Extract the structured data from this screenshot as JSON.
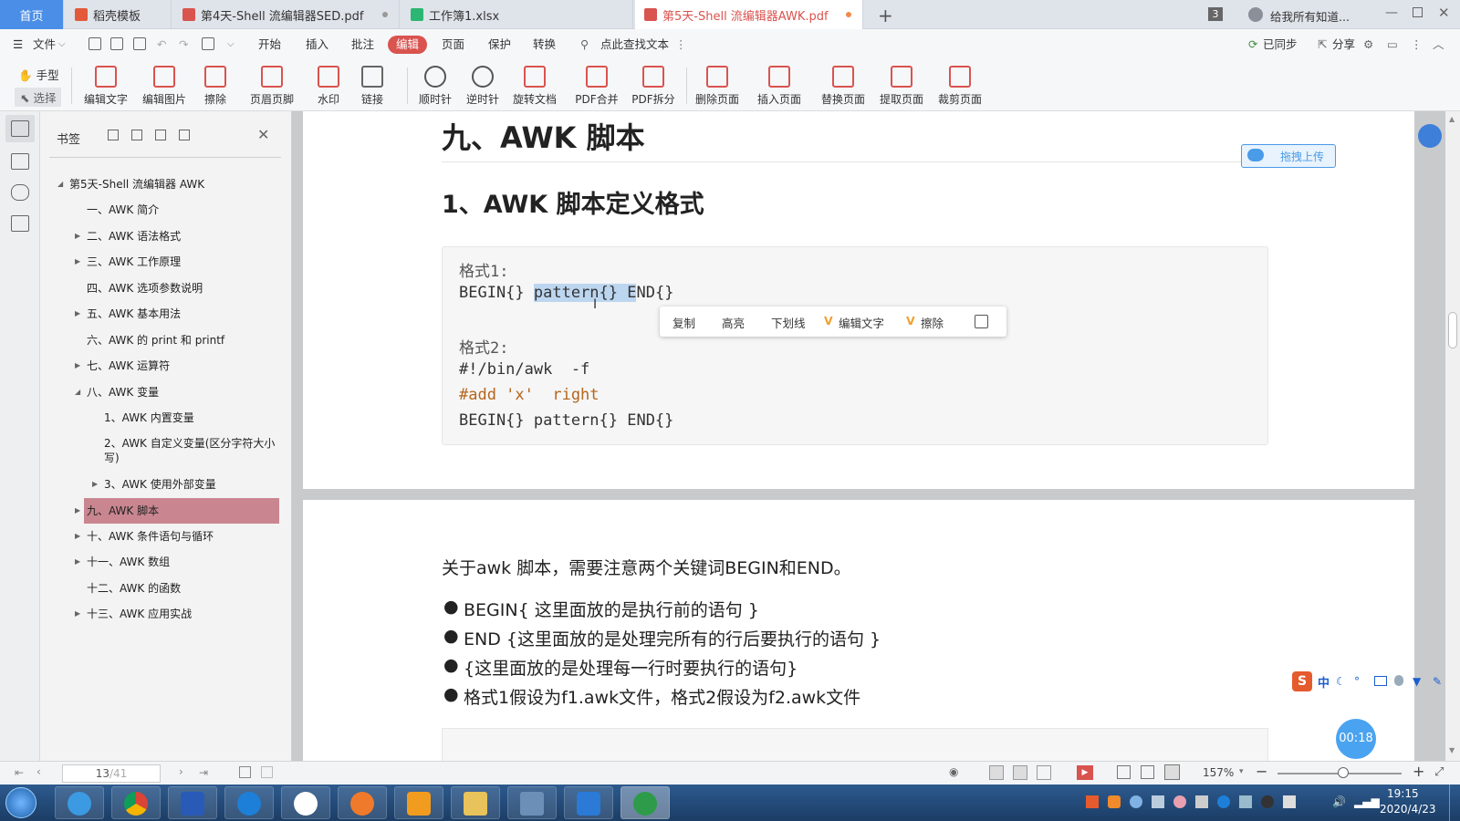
{
  "tabs": [
    {
      "label": "首页",
      "kind": "home"
    },
    {
      "label": "稻壳模板",
      "kind": "normal",
      "icon_color": "#e25a3a"
    },
    {
      "label": "第4天-Shell 流编辑器SED.pdf",
      "kind": "normal",
      "icon_color": "#d9534f"
    },
    {
      "label": "工作簿1.xlsx",
      "kind": "normal",
      "icon_color": "#2bb673"
    },
    {
      "label": "第5天-Shell 流编辑器AWK.pdf",
      "kind": "active",
      "icon_color": "#d9534f"
    }
  ],
  "titlebar": {
    "badge": "3",
    "account_text": "给我所有知道..."
  },
  "menu": {
    "file": "文件",
    "items": [
      "开始",
      "插入",
      "批注",
      "编辑",
      "页面",
      "保护",
      "转换"
    ],
    "active": "编辑",
    "search": "点此查找文本",
    "synced": "已同步",
    "share": "分享"
  },
  "ribbon": {
    "hand": "手型",
    "select": "选择",
    "tools": [
      "编辑文字",
      "编辑图片",
      "擦除",
      "页眉页脚",
      "水印",
      "链接",
      "顺时针",
      "逆时针",
      "旋转文档",
      "PDF合并",
      "PDF拆分",
      "删除页面",
      "插入页面",
      "替换页面",
      "提取页面",
      "裁剪页面"
    ]
  },
  "bookmarks": {
    "title": "书签",
    "items": [
      {
        "label": "第5天-Shell 流编辑器 AWK",
        "level": 0,
        "arrow": "down"
      },
      {
        "label": "一、AWK 简介",
        "level": 1,
        "arrow": ""
      },
      {
        "label": "二、AWK 语法格式",
        "level": 1,
        "arrow": "right"
      },
      {
        "label": "三、AWK 工作原理",
        "level": 1,
        "arrow": "right"
      },
      {
        "label": "四、AWK 选项参数说明",
        "level": 1,
        "arrow": ""
      },
      {
        "label": "五、AWK 基本用法",
        "level": 1,
        "arrow": "right"
      },
      {
        "label": "六、AWK 的 print 和 printf",
        "level": 1,
        "arrow": ""
      },
      {
        "label": "七、AWK 运算符",
        "level": 1,
        "arrow": "right"
      },
      {
        "label": "八、AWK 变量",
        "level": 1,
        "arrow": "down"
      },
      {
        "label": "1、AWK 内置变量",
        "level": 2,
        "arrow": ""
      },
      {
        "label": "2、AWK  自定义变量(区分字符大小写)",
        "level": 2,
        "arrow": ""
      },
      {
        "label": "3、AWK 使用外部变量",
        "level": 2,
        "arrow": "right"
      },
      {
        "label": "九、AWK 脚本",
        "level": 1,
        "arrow": "right",
        "selected": true
      },
      {
        "label": "十、AWK 条件语句与循环",
        "level": 1,
        "arrow": "right"
      },
      {
        "label": "十一、AWK 数组",
        "level": 1,
        "arrow": "right"
      },
      {
        "label": "十二、AWK 的函数",
        "level": 1,
        "arrow": ""
      },
      {
        "label": "十三、AWK 应用实战",
        "level": 1,
        "arrow": "right"
      }
    ]
  },
  "document": {
    "h1": "九、AWK 脚本",
    "h2": "1、AWK 脚本定义格式",
    "upload_btn": "拖拽上传",
    "code": {
      "line1": "格式1:",
      "line2_pre": "BEGIN{} ",
      "line2_sel": "pattern{} E",
      "line2_post": "ND{}",
      "line3": "格式2:",
      "line4": "#!/bin/awk  -f",
      "line5": "#add 'x'  right",
      "line6": "BEGIN{} pattern{} END{}"
    },
    "context_menu": [
      "复制",
      "高亮",
      "下划线",
      "编辑文字",
      "擦除"
    ],
    "para": "关于awk 脚本，需要注意两个关键词BEGIN和END。",
    "bullets": [
      "BEGIN{ 这里面放的是执行前的语句 }",
      "END {这里面放的是处理完所有的行后要执行的语句 }",
      "{这里面放的是处理每一行时要执行的语句}",
      "格式1假设为f1.awk文件，格式2假设为f2.awk文件"
    ],
    "timer": "00:18"
  },
  "status": {
    "page_current": "13",
    "page_total": "/41",
    "zoom": "157%"
  },
  "taskbar": {
    "time": "19:15",
    "date": "2020/4/23",
    "ime": "中"
  }
}
